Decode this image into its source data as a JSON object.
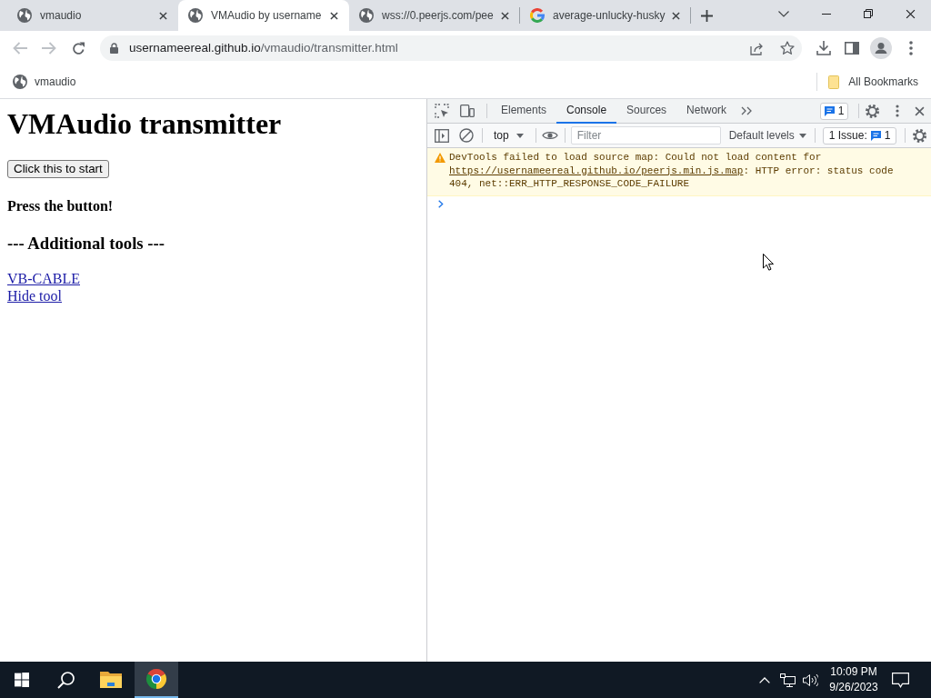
{
  "browser": {
    "tabs": [
      {
        "kind": "globe",
        "title": "vmaudio",
        "selected": false
      },
      {
        "kind": "globe",
        "title": "VMAudio by username",
        "selected": true
      },
      {
        "kind": "globe",
        "title": "wss://0.peerjs.com/pee",
        "selected": false
      },
      {
        "kind": "letter-g",
        "title": "average-unlucky-husky",
        "selected": false
      }
    ],
    "navigation": {
      "back_disabled": true,
      "forward_disabled": true
    },
    "address": {
      "host": "usernameereal.github.io",
      "path": "/vmaudio/transmitter.html"
    },
    "bookmarks": [
      {
        "title": "vmaudio"
      }
    ],
    "all_bookmarks": "All Bookmarks"
  },
  "page": {
    "heading": "VMAudio transmitter",
    "start_button": "Click this to start",
    "status": "Press the button!",
    "tools_heading": "--- Additional tools ---",
    "links": [
      "VB-CABLE",
      "Hide tool"
    ]
  },
  "devtools": {
    "tabs": [
      {
        "label": "Elements",
        "selected": false
      },
      {
        "label": "Console",
        "selected": true
      },
      {
        "label": "Sources",
        "selected": false
      },
      {
        "label": "Network",
        "selected": false
      }
    ],
    "messages_badge": "1",
    "context": "top",
    "filter": {
      "placeholder": "Filter"
    },
    "levels": "Default levels",
    "issues": {
      "label": "1 Issue:",
      "count": "1"
    },
    "console": [
      {
        "kind": "warning",
        "text": "DevTools failed to load source map: Could not load content for",
        "link": "https://usernameereal.github.io/peerjs.min.js.map",
        "after": ": HTTP error: status code 404, net::ERR_HTTP_RESPONSE_CODE_FAILURE"
      }
    ]
  },
  "taskbar": {
    "apps": [
      {
        "kind": "folder",
        "active": false
      },
      {
        "kind": "browser",
        "active": true
      }
    ],
    "time": "10:09 PM",
    "date": "9/26/2023"
  }
}
